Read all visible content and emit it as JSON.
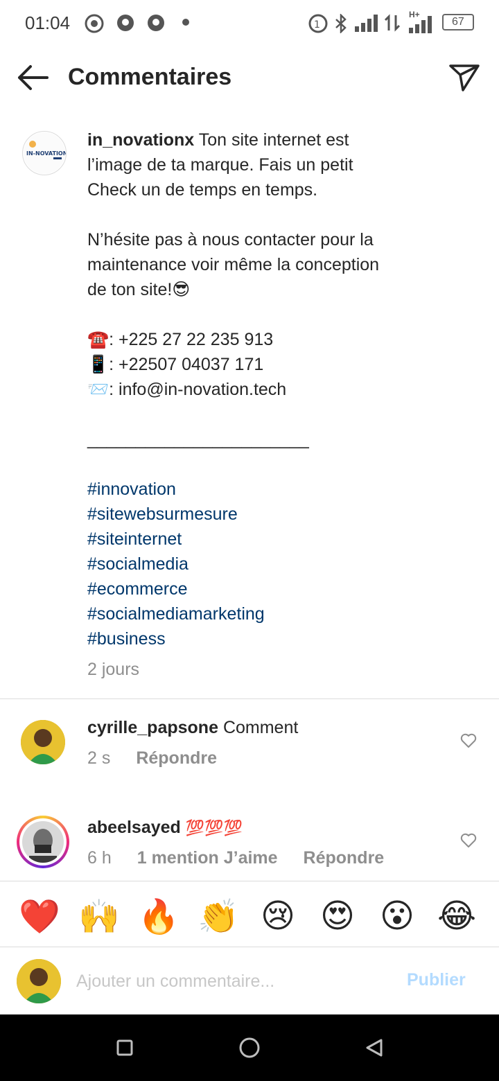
{
  "status_bar": {
    "time": "01:04",
    "battery": "67",
    "network": "H+"
  },
  "header": {
    "title": "Commentaires"
  },
  "caption": {
    "username": "in_novationx",
    "line1": "Ton site internet est",
    "line2": "l’image de ta marque. Fais un petit",
    "line3": "Check un de temps en temps.",
    "line4": "N’hésite pas à nous contacter pour la",
    "line5": "maintenance voir même la conception",
    "line6": "de ton site!😎",
    "phone1": "☎️: +225 27 22 235 913",
    "phone2": "📱: +22507 04037 171",
    "email": "📨: info@in-novation.tech",
    "separator": "_______________________",
    "hashtags": [
      "#innovation",
      "#sitewebsurmesure",
      "#siteinternet",
      "#socialmedia",
      "#ecommerce",
      "#socialmediamarketing",
      "#business"
    ],
    "time": "2 jours",
    "avatar_text": "IN-NOVATION"
  },
  "comments": [
    {
      "username": "cyrille_papsone",
      "text": "Comment",
      "time": "2 s",
      "reply": "Répondre"
    },
    {
      "username": "abeelsayed",
      "text": "💯💯💯",
      "time": "6 h",
      "likes": "1 mention J’aime",
      "reply": "Répondre"
    }
  ],
  "reactions": [
    "❤️",
    "🙌",
    "🔥",
    "👏",
    "😢",
    "😍",
    "😮",
    "😂"
  ],
  "composer": {
    "placeholder": "Ajouter un commentaire...",
    "publish": "Publier"
  },
  "colors": {
    "hashtag": "#00376b",
    "meta": "#8e8e8e",
    "publish_disabled": "#b3dbff"
  }
}
